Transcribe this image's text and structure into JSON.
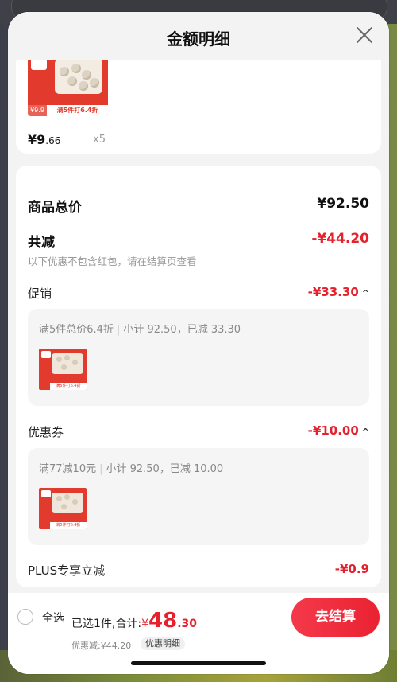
{
  "sheet": {
    "title": "金额明细"
  },
  "product": {
    "price_main": "¥9",
    "price_decimal": ".66",
    "quantity": "x5",
    "img_tag": "满5件打6.4折",
    "img_price": "¥9.9"
  },
  "summary": {
    "total_label": "商品总价",
    "total_value": "¥92.50",
    "reduce_label": "共减",
    "reduce_value": "-¥44.20",
    "reduce_note": "以下优惠不包含红包，请在结算页查看"
  },
  "promotion": {
    "label": "促销",
    "value": "-¥33.30",
    "caret": "^",
    "rule": "满5件总价6.4折",
    "sep": "|",
    "detail": "小计 92.50，已减 33.30"
  },
  "coupon": {
    "label": "优惠券",
    "value": "-¥10.00",
    "caret": "^",
    "rule": "满77减10元",
    "sep": "|",
    "detail": "小计 92.50，已减 10.00"
  },
  "plus": {
    "label": "PLUS专享立减",
    "value": "-¥0.9"
  },
  "footer": {
    "select_all": "全选",
    "selected_text": "已选1件,合计:",
    "currency": "¥",
    "amount_big": "48",
    "amount_cents": ".30",
    "discount_text": "优惠减:¥44.20",
    "detail_chip": "优惠明细",
    "checkout": "去结算"
  },
  "colors": {
    "accent": "#e5212d",
    "checkout_button": "#f0303f"
  },
  "icons": {
    "close": "close-icon",
    "caret": "chevron-up-icon"
  }
}
